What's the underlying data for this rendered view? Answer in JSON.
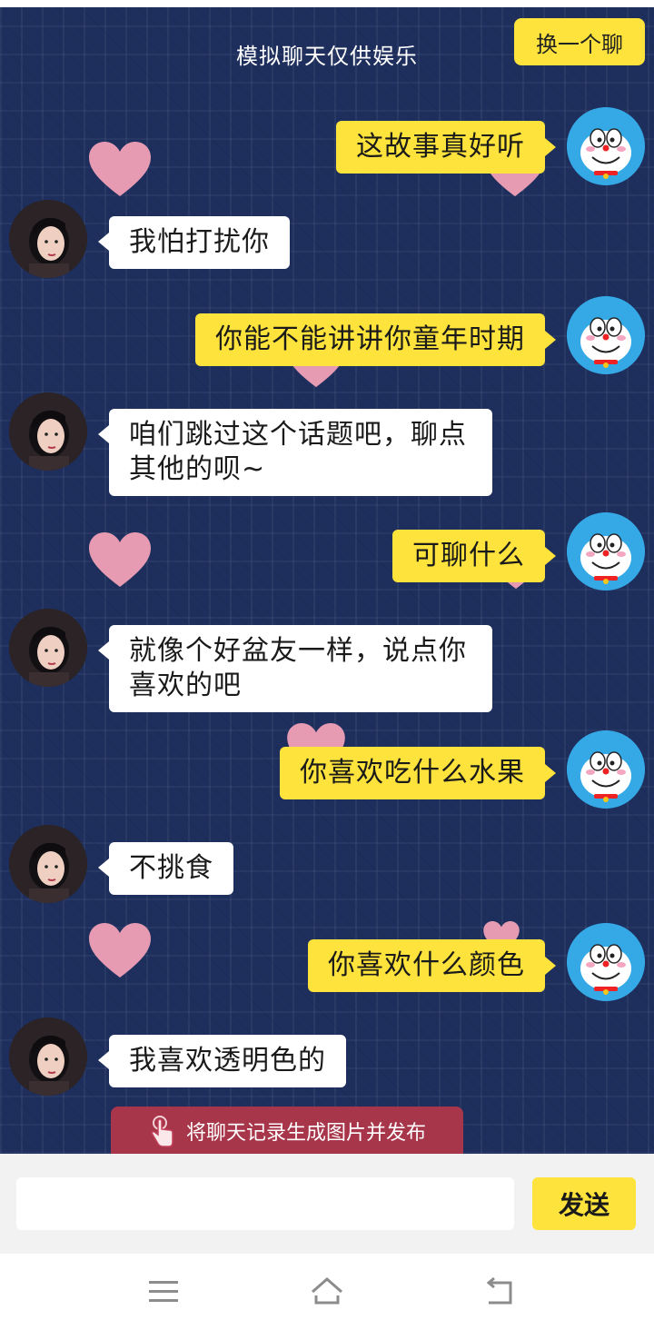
{
  "header": {
    "title": "模拟聊天仅供娱乐",
    "switch_label": "换一个聊"
  },
  "messages": [
    {
      "side": "user",
      "text": "这故事真好听"
    },
    {
      "side": "bot",
      "text": "我怕打扰你"
    },
    {
      "side": "user",
      "text": "你能不能讲讲你童年时期"
    },
    {
      "side": "bot",
      "text": "咱们跳过这个话题吧，聊点其他的呗~"
    },
    {
      "side": "user",
      "text": "可聊什么"
    },
    {
      "side": "bot",
      "text": "就像个好盆友一样，说点你喜欢的吧"
    },
    {
      "side": "user",
      "text": "你喜欢吃什么水果"
    },
    {
      "side": "bot",
      "text": "不挑食"
    },
    {
      "side": "user",
      "text": "你喜欢什么颜色"
    },
    {
      "side": "bot",
      "text": "我喜欢透明色的"
    }
  ],
  "generate_button": {
    "label": "将聊天记录生成图片并发布",
    "icon": "hand-pointer-icon"
  },
  "composer": {
    "input_value": "",
    "input_placeholder": "",
    "send_label": "发送"
  },
  "nav": {
    "icons": [
      "menu-icon",
      "home-icon",
      "back-icon"
    ]
  },
  "colors": {
    "chat_bg": "#1e2f5d",
    "user_bubble": "#fde33b",
    "bot_bubble": "#ffffff",
    "generate_button": "#a8364a",
    "heart": "#e79bb3"
  }
}
